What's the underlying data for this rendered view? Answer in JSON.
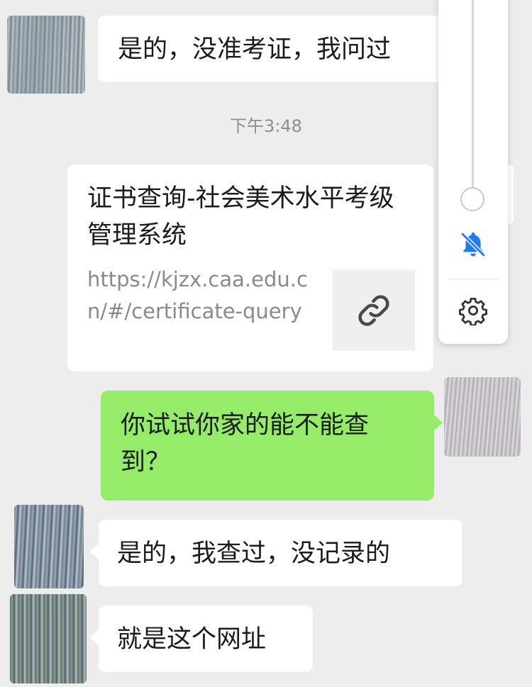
{
  "messages": {
    "msg1": "是的，没准考证，我问过",
    "timestamp": "下午3:48",
    "link_card": {
      "title": "证书查询-社会美术水平考级管理系统",
      "url": "https://kjzx.caa.edu.cn/#/certificate-query",
      "thumb_icon": "link-icon"
    },
    "msg_green": "你试试你家的能不能查到？",
    "msg3": "是的，我查过，没记录的",
    "msg4": "就是这个网址"
  },
  "panel": {
    "bell_icon": "bell-muted-icon",
    "settings_icon": "gear-icon",
    "accent_color": "#1e7cf0"
  },
  "colors": {
    "background": "#ededed",
    "incoming_bubble": "#ffffff",
    "outgoing_bubble": "#95ec69"
  }
}
